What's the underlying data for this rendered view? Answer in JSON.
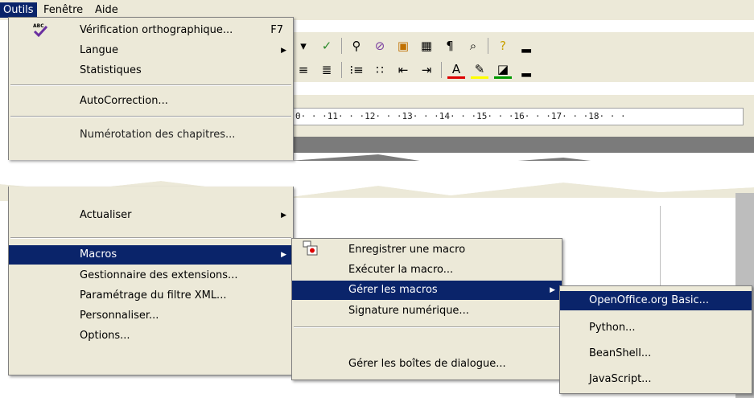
{
  "menubar": {
    "items": [
      "Outils",
      "Fenêtre",
      "Aide"
    ]
  },
  "outils_menu": {
    "items": [
      {
        "label": "Vérification orthographique...",
        "shortcut": "F7"
      },
      {
        "label": "Langue"
      },
      {
        "label": "Statistiques"
      },
      {
        "label": "AutoCorrection..."
      },
      {
        "label": "Numérotation des chapitres..."
      },
      {
        "label": "Actualiser"
      },
      {
        "label": "Macros"
      },
      {
        "label": "Gestionnaire des extensions..."
      },
      {
        "label": "Paramétrage du filtre XML..."
      },
      {
        "label": "Personnaliser..."
      },
      {
        "label": "Options..."
      }
    ]
  },
  "macros_menu": {
    "items": [
      {
        "label": "Enregistrer une macro"
      },
      {
        "label": "Exécuter la macro..."
      },
      {
        "label": "Gérer les macros"
      },
      {
        "label": "Signature numérique..."
      },
      {
        "label": "Gérer les boîtes de dialogue..."
      }
    ]
  },
  "gerer_menu": {
    "items": [
      {
        "label": "OpenOffice.org Basic..."
      },
      {
        "label": "Python..."
      },
      {
        "label": "BeanShell..."
      },
      {
        "label": "JavaScript..."
      }
    ]
  },
  "ruler": {
    "text": "0· · ·11· · ·12· · ·13· · ·14· · ·15· · ·16· · ·17· · ·18· · ·"
  },
  "colors": {
    "highlight": "#0a246a",
    "menu_bg": "#ece9d8"
  }
}
